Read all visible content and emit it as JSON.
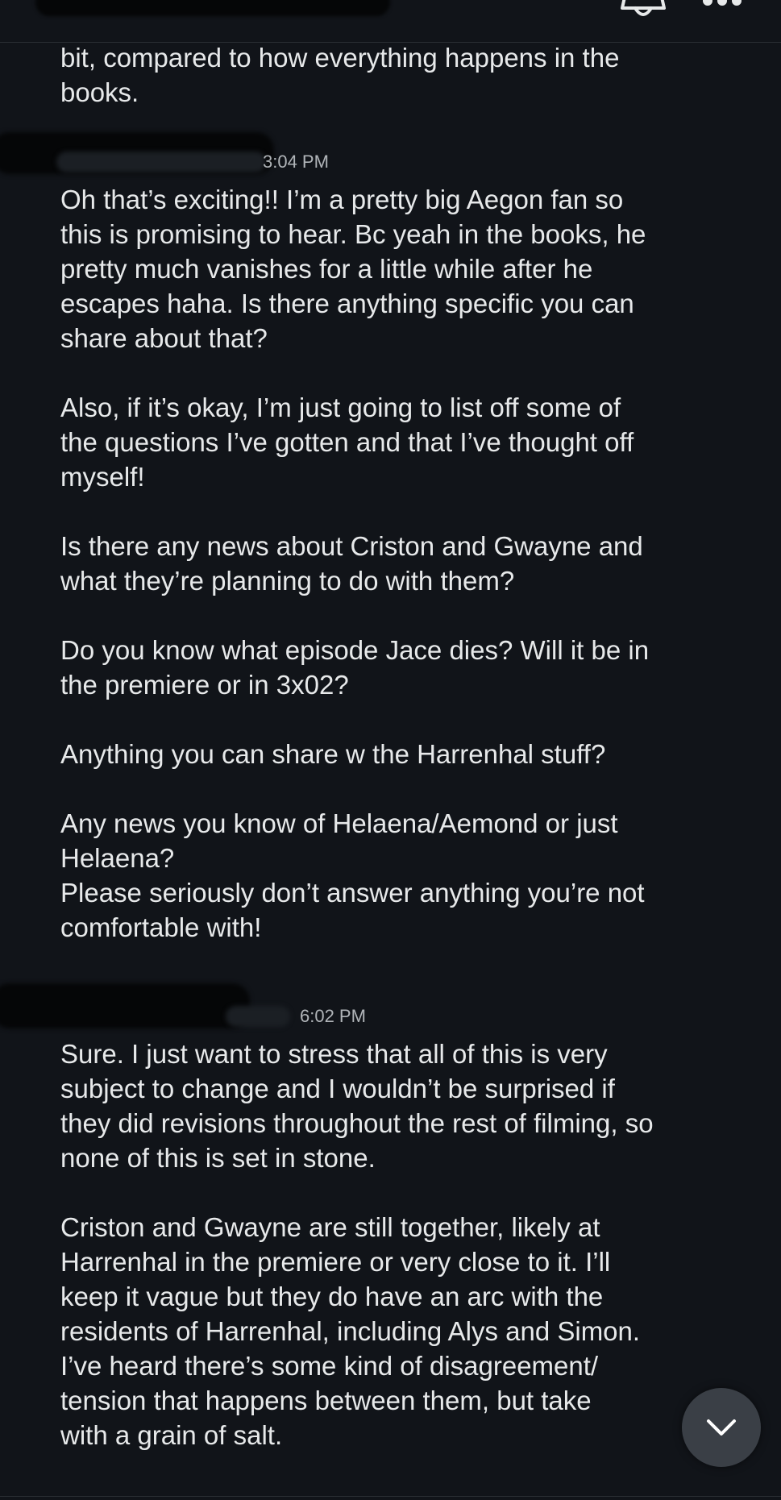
{
  "messages": [
    {
      "id": "m1",
      "timestamp": "",
      "text": "bit, compared to how everything happens in the\nbooks."
    },
    {
      "id": "m2",
      "timestamp": "3:04 PM",
      "text": "Oh that’s exciting!! I’m a pretty big Aegon fan so\nthis is promising to hear. Bc yeah in the books, he\npretty much vanishes for a little while after he\nescapes haha. Is there anything specific you can\nshare about that?\n\nAlso, if it’s okay, I’m just going to list off some of\nthe questions I’ve gotten and that I’ve thought off\nmyself!\n\nIs there any news about Criston and Gwayne and\nwhat they’re planning to do with them?\n\nDo you know what episode Jace dies? Will it be in\nthe premiere or in 3x02?\n\nAnything you can share w the Harrenhal stuff?\n\nAny news you know of Helaena/Aemond or just\nHelaena?\nPlease seriously don’t answer anything you’re not\ncomfortable with!"
    },
    {
      "id": "m3",
      "timestamp": "6:02 PM",
      "text": "Sure. I just want to stress that all of this is very\nsubject to change and I wouldn’t be surprised if\nthey did revisions throughout the rest of filming, so\nnone of this is set in stone.\n\nCriston and Gwayne are still together, likely at\nHarrenhal in the premiere or very close to it. I’ll\nkeep it vague but they do have an arc with the\nresidents of Harrenhal, including Alys and Simon.\nI’ve heard there’s some kind of disagreement/\ntension that happens between them, but take\nwith a grain of salt."
    }
  ],
  "icons": {
    "bell": "bell-icon",
    "more": "more-options-icon",
    "scroll": "chevron-down-icon"
  },
  "colors": {
    "background": "#111419",
    "text": "#e7e9ea",
    "timestamp": "#b0b4b8",
    "fab": "#3a3f46"
  }
}
